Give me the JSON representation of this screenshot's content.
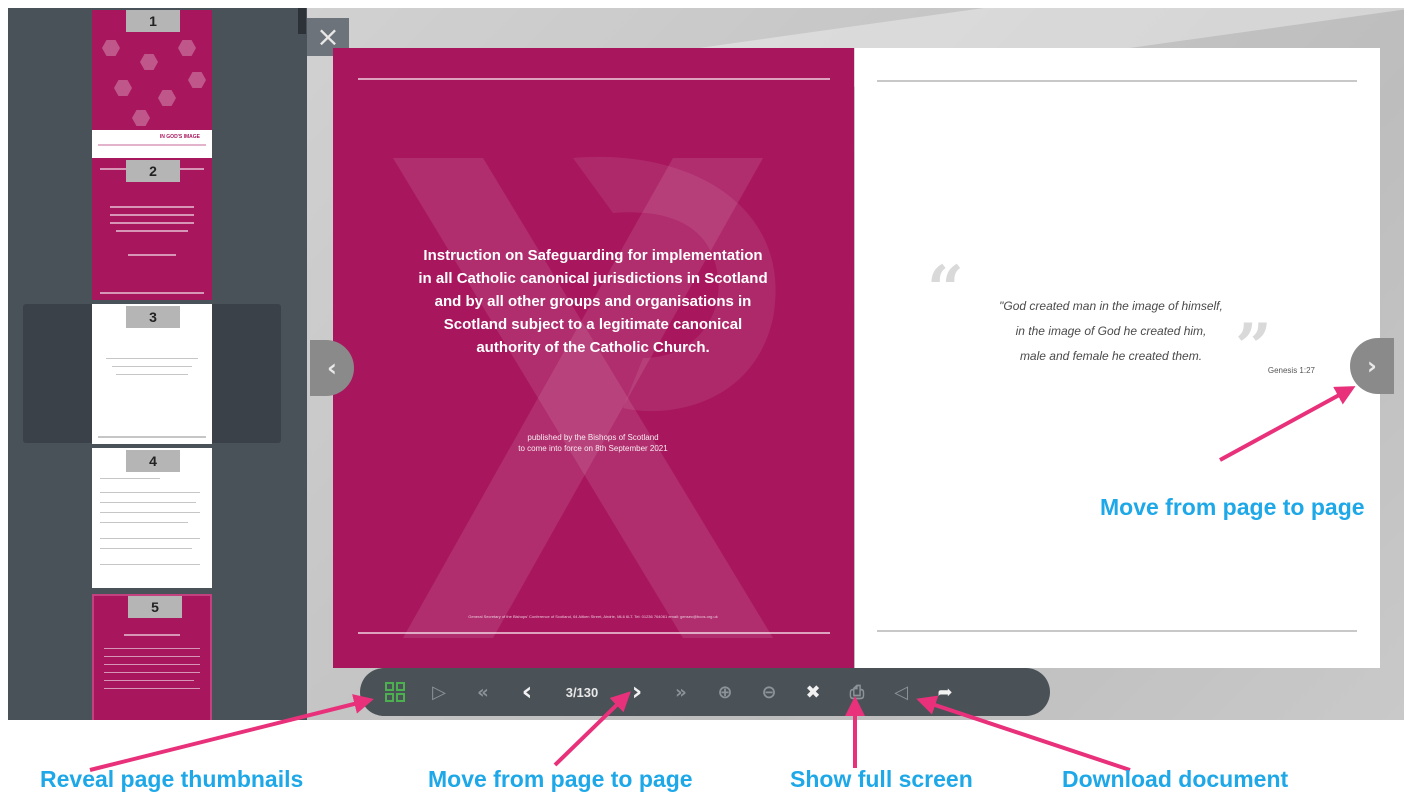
{
  "viewer": {
    "close_glyph": "×",
    "prev_glyph": "‹",
    "next_glyph": "›"
  },
  "thumbnails": [
    {
      "number": "1",
      "color": "magenta",
      "caption": "IN GOD'S IMAGE"
    },
    {
      "number": "2",
      "color": "magenta"
    },
    {
      "number": "3",
      "color": "white",
      "active": true
    },
    {
      "number": "4",
      "color": "white"
    },
    {
      "number": "5",
      "color": "magenta"
    }
  ],
  "left_page": {
    "title": "Instruction on Safeguarding for implementation\nin all Catholic canonical jurisdictions in Scotland\nand by all other groups and organisations in\nScotland subject to a legitimate canonical\nauthority of the Catholic Church.",
    "publish_note": "published by the Bishops of Scotland\nto come into force on 8th September 2021",
    "footer": "General Secretary of the Bishops' Conference of Scotland, 64 Aitken Street, Airdrie, ML6 6LT. Tel: 01236 764061 email: gensec@bcos.org.uk",
    "bg_color": "#a8175e"
  },
  "right_page": {
    "quote": "\"God created man in the image of himself,\nin the image of God he created him,\nmale and female he created them.",
    "reference": "Genesis 1:27"
  },
  "toolbar": {
    "thumbnails_icon": "grid-icon",
    "play_glyph": "▷",
    "first_glyph": "«",
    "prev_glyph": "‹",
    "page_counter": "3/130",
    "next_glyph": "›",
    "last_glyph": "»",
    "zoom_in_glyph": "⊕",
    "zoom_out_glyph": "⊖",
    "fullscreen_glyph": "✖",
    "download_glyph": "⎙",
    "sound_glyph": "◁",
    "share_glyph": "➦",
    "accent_color": "#4caf50"
  },
  "annotations": {
    "thumbnails": "Reveal page thumbnails",
    "move_toolbar": "Move from page to page",
    "fullscreen": "Show full screen",
    "download": "Download document",
    "move_arrow": "Move from page to page",
    "label_color": "#1ea8e8",
    "arrow_color": "#e8317a"
  }
}
